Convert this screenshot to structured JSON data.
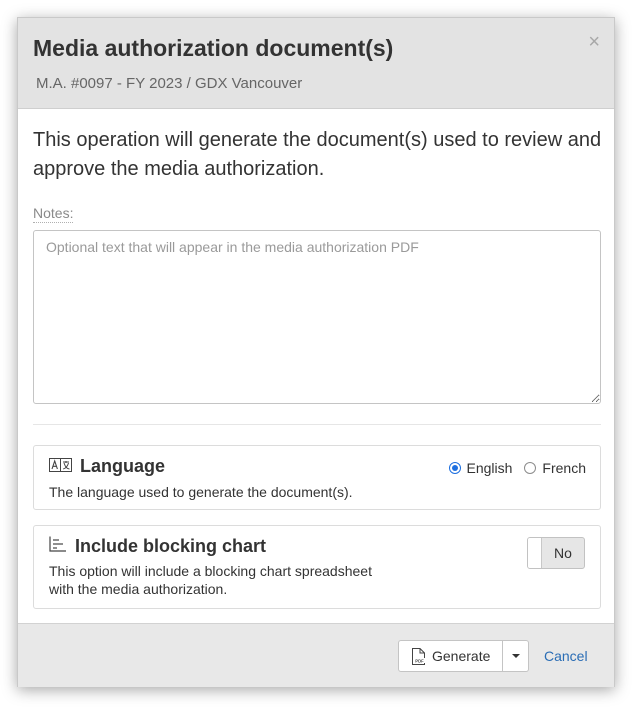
{
  "dialog": {
    "title": "Media authorization document(s)",
    "subtitle": "M.A. #0097 -  FY 2023 / GDX Vancouver",
    "close_glyph": "×"
  },
  "intro_text": "This operation will generate the document(s) used to review and approve the media authorization.",
  "notes": {
    "label": "Notes:",
    "value": "",
    "placeholder": "Optional text that will appear in the media authorization PDF"
  },
  "language": {
    "icon": "translate-icon",
    "title": "Language",
    "description": "The language used to generate the document(s).",
    "options": [
      {
        "label": "English",
        "selected": true
      },
      {
        "label": "French",
        "selected": false
      }
    ]
  },
  "blocking_chart": {
    "icon": "chart-icon",
    "title": "Include blocking chart",
    "description": "This option will include a blocking chart spreadsheet with the media authorization.",
    "toggle_label": "No",
    "enabled": false
  },
  "footer": {
    "generate_label": "Generate",
    "generate_icon": "pdf-file-icon",
    "cancel_label": "Cancel"
  },
  "colors": {
    "accent": "#1d6fe0",
    "link": "#2a6db5",
    "header_bg": "#e3e3e3",
    "footer_bg": "#e8e8e8"
  }
}
